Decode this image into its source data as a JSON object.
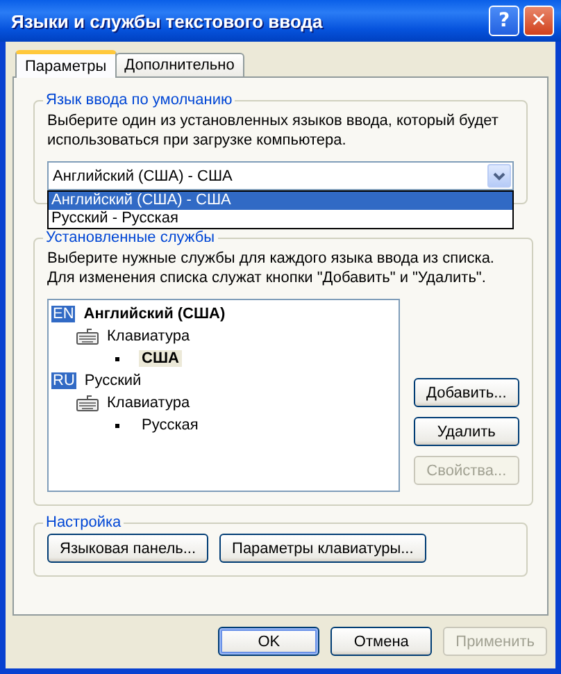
{
  "window": {
    "title": "Языки и службы текстового ввода",
    "title_buttons": [
      "?",
      "✕"
    ]
  },
  "tabs": [
    {
      "label": "Параметры",
      "selected": true
    },
    {
      "label": "Дополнительно",
      "selected": false
    }
  ],
  "default_language": {
    "legend": "Язык ввода по умолчанию",
    "description": "Выберите один из установленных языков ввода, который будет использоваться при загрузке компьютера.",
    "value": "Английский (США) - США",
    "expanded": true,
    "options": [
      {
        "label": "Английский (США) - США",
        "selected": true
      },
      {
        "label": "Русский - Русская",
        "selected": false
      }
    ]
  },
  "installed_services": {
    "legend": "Установленные службы",
    "description": "Выберите нужные службы для каждого языка ввода из списка. Для изменения списка служат кнопки \"Добавить\" и \"Удалить\".",
    "tree": [
      {
        "kind": "language",
        "code": "EN",
        "label": "Английский (США)",
        "default": true,
        "children": [
          {
            "kind": "category",
            "label": "Клавиатура",
            "children": [
              {
                "kind": "layout",
                "label": "США",
                "default": true,
                "selected": true
              }
            ]
          }
        ]
      },
      {
        "kind": "language",
        "code": "RU",
        "label": "Русский",
        "default": false,
        "children": [
          {
            "kind": "category",
            "label": "Клавиатура",
            "children": [
              {
                "kind": "layout",
                "label": "Русская",
                "default": false,
                "selected": false
              }
            ]
          }
        ]
      }
    ],
    "buttons": [
      {
        "label": "Добавить...",
        "disabled": false
      },
      {
        "label": "Удалить",
        "disabled": false
      },
      {
        "label": "Свойства...",
        "disabled": true
      }
    ]
  },
  "settings": {
    "legend": "Настройка",
    "buttons": [
      {
        "label": "Языковая панель...",
        "disabled": false
      },
      {
        "label": "Параметры клавиатуры...",
        "disabled": false
      }
    ]
  },
  "dialog_buttons": [
    {
      "label": "OK",
      "disabled": false,
      "default": true
    },
    {
      "label": "Отмена",
      "disabled": false,
      "default": false
    },
    {
      "label": "Применить",
      "disabled": true,
      "default": false
    }
  ]
}
